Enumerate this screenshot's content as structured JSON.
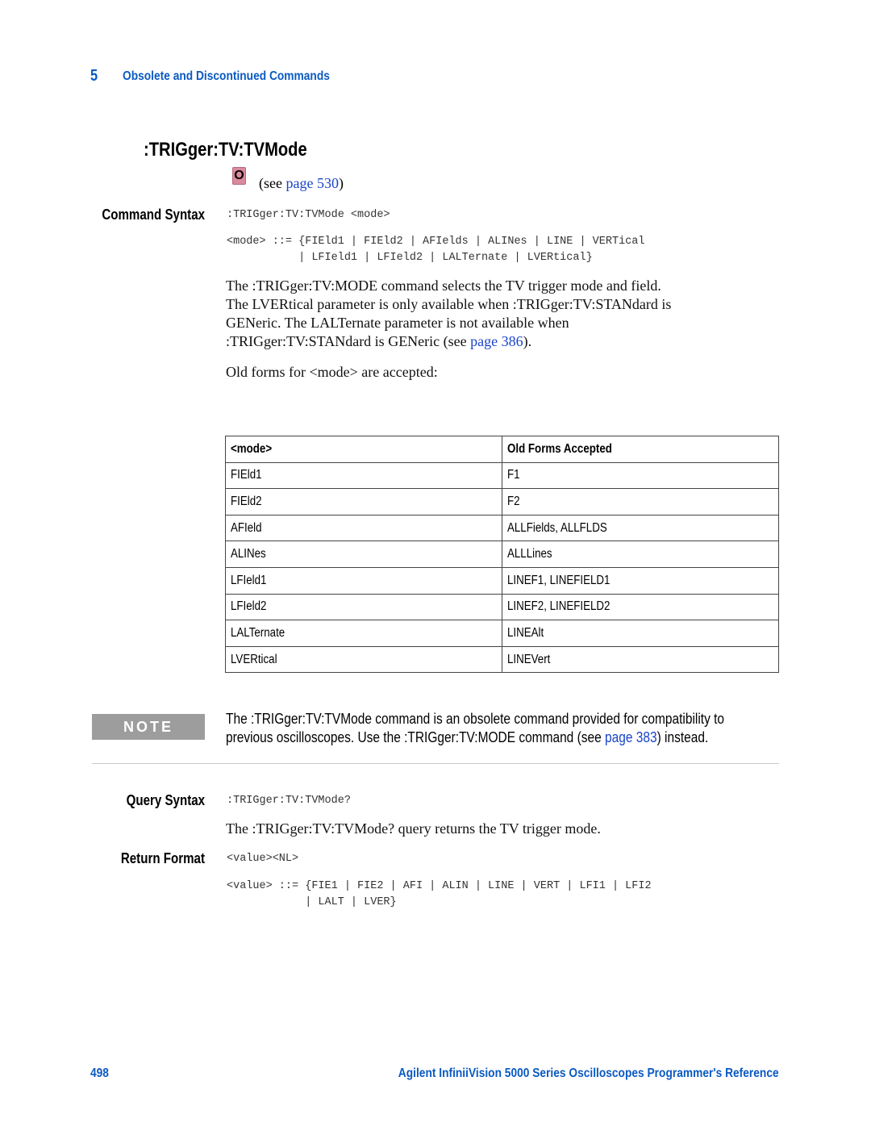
{
  "header": {
    "chapter_number": "5",
    "chapter_title": "Obsolete and Discontinued Commands"
  },
  "command": {
    "title": ":TRIGger:TV:TVMode",
    "obsolete_badge": "O",
    "see_prefix": "(see ",
    "see_link": "page 530",
    "see_suffix": ")"
  },
  "command_syntax": {
    "label": "Command Syntax",
    "syntax": ":TRIGger:TV:TVMode <mode>",
    "mode_def_line1": "<mode> ::= {FIEld1 | FIEld2 | AFIelds | ALINes | LINE | VERTical",
    "mode_def_line2": "           | LFIeld1 | LFIeld2 | LALTernate | LVERtical}"
  },
  "description": {
    "line1": "The :TRIGger:TV:MODE command selects the TV trigger mode and field.",
    "line2": "The LVERtical parameter is only available when :TRIGger:TV:STANdard is",
    "line3": "GENeric. The LALTernate parameter is not available when",
    "line4_prefix": ":TRIGger:TV:STANdard is GENeric (see ",
    "line4_link": "page 386",
    "line4_suffix": ").",
    "old_forms": "Old forms for <mode> are accepted:"
  },
  "forms_table": {
    "headers": [
      "<mode>",
      "Old Forms Accepted"
    ],
    "rows": [
      [
        "FIEld1",
        "F1"
      ],
      [
        "FIEld2",
        "F2"
      ],
      [
        "AFIeld",
        "ALLFields, ALLFLDS"
      ],
      [
        "ALINes",
        "ALLLines"
      ],
      [
        "LFIeld1",
        "LINEF1, LINEFIELD1"
      ],
      [
        "LFIeld2",
        "LINEF2, LINEFIELD2"
      ],
      [
        "LALTernate",
        "LINEAlt"
      ],
      [
        "LVERtical",
        "LINEVert"
      ]
    ]
  },
  "note": {
    "badge": "NOTE",
    "line1": "The :TRIGger:TV:TVMode command is an obsolete command provided for compatibility to",
    "line2_prefix": "previous oscilloscopes. Use the :TRIGger:TV:MODE command (see ",
    "line2_link": "page 383",
    "line2_suffix": ") instead."
  },
  "query_syntax": {
    "label": "Query Syntax",
    "syntax": ":TRIGger:TV:TVMode?",
    "description": "The :TRIGger:TV:TVMode? query returns the TV trigger mode."
  },
  "return_format": {
    "label": "Return Format",
    "format": "<value><NL>",
    "value_def_line1": "<value> ::= {FIE1 | FIE2 | AFI | ALIN | LINE | VERT | LFI1 | LFI2",
    "value_def_line2": "            | LALT | LVER}"
  },
  "footer": {
    "page_number": "498",
    "book_title": "Agilent InfiniiVision 5000 Series Oscilloscopes Programmer's Reference"
  }
}
